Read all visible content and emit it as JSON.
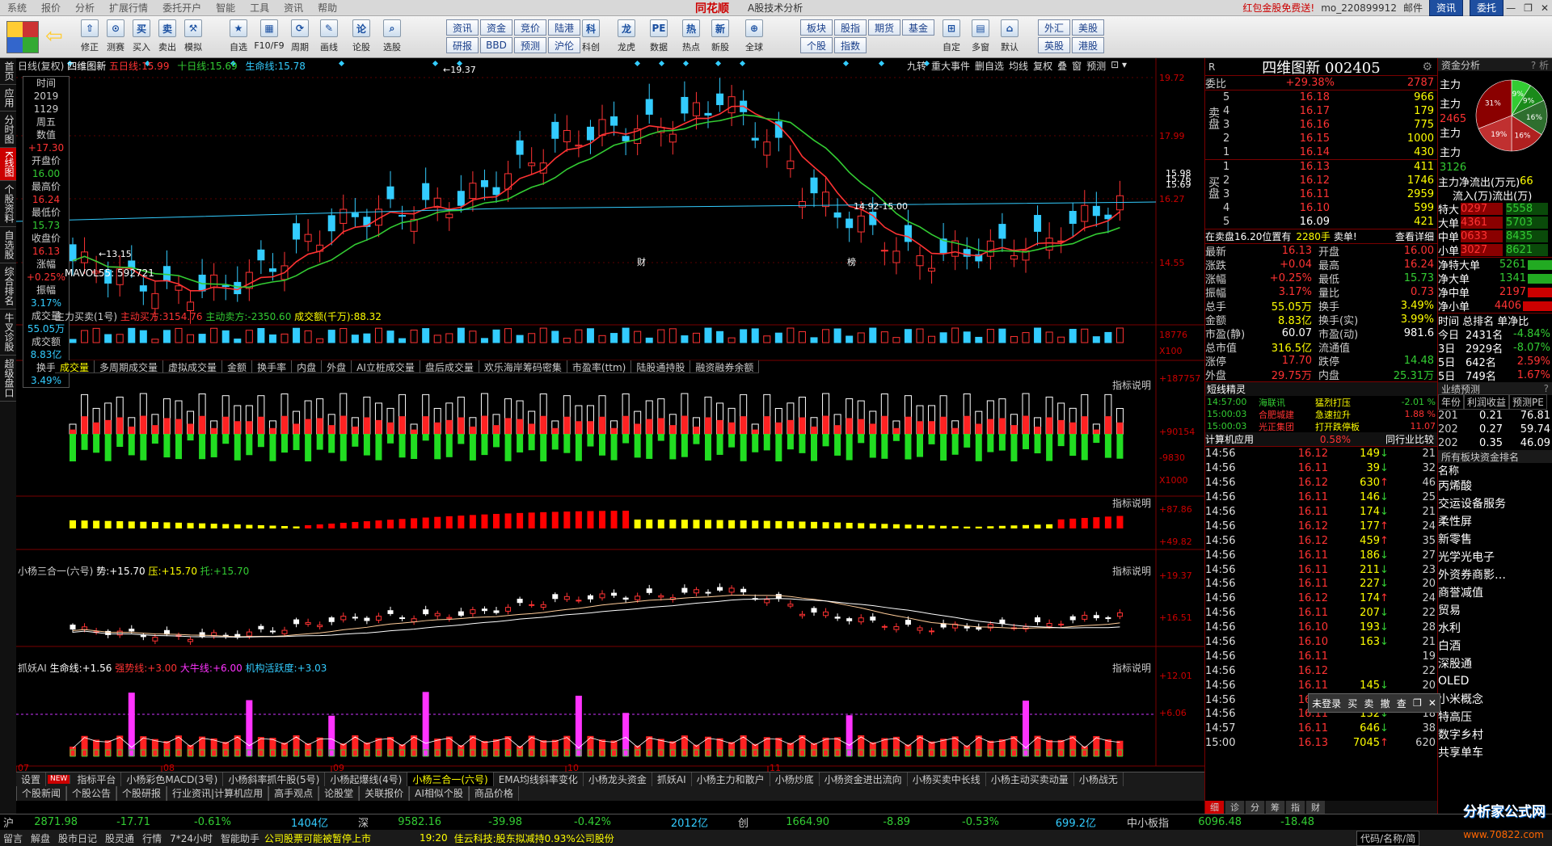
{
  "menu": {
    "items": [
      "系统",
      "报价",
      "分析",
      "扩展行情",
      "委托开户",
      "智能",
      "工具",
      "资讯",
      "帮助"
    ],
    "logo": "同花顺",
    "title": "A股技术分析",
    "promo": "红包金股免费送!",
    "user": "mo_220899912",
    "mail": "邮件",
    "news_btn": "资讯",
    "trade_btn": "委托"
  },
  "toolbar": {
    "buttons": [
      "修正",
      "测赛",
      "买入",
      "卖出",
      "模拟",
      "自选",
      "F10/F9",
      "周期",
      "画线",
      "论股",
      "选股",
      "科创",
      "龙虎",
      "数据",
      "热点",
      "新股",
      "全球",
      "自定",
      "多窗",
      "默认"
    ],
    "grid": [
      "资讯",
      "资金",
      "竞价",
      "陆港",
      "研报",
      "BBD",
      "预测",
      "沪伦",
      "板块",
      "股指",
      "期权",
      "债券",
      "英股",
      "港股",
      "个股",
      "指数",
      "期货",
      "基金",
      "外汇",
      "美股"
    ]
  },
  "leftnav": [
    "首页",
    "应用",
    "分时图",
    "K线图",
    "个股资料",
    "自选股",
    "综合排名",
    "牛叉诊股",
    "超级盘口"
  ],
  "chart": {
    "title_line": "日线(复权)",
    "stock_name": "四维图新",
    "ma5_label": "五日线:",
    "ma5": "15.99",
    "ma10_label": "十日线:",
    "ma10": "15.69",
    "life_label": "生命线:",
    "life": "15.78",
    "top_tools": [
      "九转",
      "重大事件",
      "删自选",
      "均线",
      "复权",
      "叠",
      "窗",
      "预测"
    ],
    "yaxis": [
      "19.72",
      "17.99",
      "16.27",
      "14.55"
    ],
    "price_callouts": {
      "high": "19.37",
      "low": "13.15",
      "range": "14.92-15.00",
      "p1": "15.98",
      "p2": "15.76",
      "p3": "15.69"
    },
    "markers": [
      "财",
      "榜"
    ],
    "vol_label": "MAVOL55: 592721",
    "vol_axis": [
      "18776",
      "X100"
    ],
    "ind_tabs": [
      "成交量",
      "多周期成交量",
      "虚拟成交量",
      "金额",
      "换手率",
      "内盘",
      "外盘",
      "AI立桩成交量",
      "盘后成交量",
      "欢乐海岸筹码密集",
      "市盈率(ttm)",
      "陆股通持股",
      "融资融券余额"
    ],
    "p2_label": "主力买卖(1号)",
    "p2_buy_label": "主动买方:",
    "p2_buy": "3154.76",
    "p2_sell_label": "主动卖方:",
    "p2_sell": "-2350.60",
    "p2_amt_label": "成交额(千万):",
    "p2_amt": "88.32",
    "p2_axis": [
      "+187757",
      "+90154",
      "-9830",
      "X1000"
    ],
    "p3_axis": [
      "+87.86",
      "+49.82"
    ],
    "p4_label": "小杨三合一(六号)",
    "p4_a_label": "势:",
    "p4_a": "+15.70",
    "p4_b_label": "压:",
    "p4_b": "+15.70",
    "p4_c_label": "托:",
    "p4_c": "+15.70",
    "p4_axis": [
      "+19.37",
      "+16.51"
    ],
    "p5_label": "抓妖AI",
    "p5_a_label": "生命线:",
    "p5_a": "+1.56",
    "p5_b_label": "强势线:",
    "p5_b": "+3.00",
    "p5_c_label": "大牛线:",
    "p5_c": "+6.00",
    "p5_d_label": "机构活跃度:",
    "p5_d": "+3.03",
    "p5_axis": [
      "+12.01",
      "+6.06"
    ],
    "indicator_help": "指标说明",
    "xaxis": [
      "07",
      "08",
      "09",
      "10",
      "11"
    ],
    "info": {
      "time_label": "时间",
      "year": "2019",
      "date": "1129",
      "weekday": "周五",
      "values_label": "数值",
      "v1": "+17.30",
      "open_label": "开盘价",
      "open": "16.00",
      "high_label": "最高价",
      "high": "16.24",
      "low_label": "最低价",
      "low": "15.73",
      "close_label": "收盘价",
      "close": "16.13",
      "chg_label": "涨幅",
      "chg": "+0.25%",
      "amp_label": "振幅",
      "amp": "3.17%",
      "vol_label": "成交量",
      "vol": "55.05万",
      "amt_label": "成交额",
      "amt": "8.83亿",
      "turn_label": "换手",
      "turn": "3.49%"
    }
  },
  "tabs1": [
    "设置",
    "NEW",
    "指标平台",
    "小杨彩色MACD(3号)",
    "小杨斜率抓牛股(5号)",
    "小杨起爆线(4号)",
    "小杨三合一(六号)",
    "EMA均线斜率变化",
    "小杨龙头资金",
    "抓妖AI",
    "小杨主力和散户",
    "小杨炒底",
    "小杨资金进出流向",
    "小杨买卖中长线",
    "小杨主动买卖动量",
    "小杨战无"
  ],
  "tabs2": [
    "个股新闻",
    "个股公告",
    "个股研报",
    "行业资讯|计算机应用",
    "高手观点",
    "论股堂",
    "关联报价",
    "AI相似个股",
    "商品价格"
  ],
  "quote": {
    "r": "R",
    "title": "四维图新 002405",
    "wb_label": "委比",
    "wb": "+29.38%",
    "wb_v": "2787",
    "sell_label": "卖盘",
    "buy_label": "买盘",
    "sells": [
      {
        "l": "5",
        "p": "16.18",
        "v": "966"
      },
      {
        "l": "4",
        "p": "16.17",
        "v": "179"
      },
      {
        "l": "3",
        "p": "16.16",
        "v": "775"
      },
      {
        "l": "2",
        "p": "16.15",
        "v": "1000"
      },
      {
        "l": "1",
        "p": "16.14",
        "v": "430"
      }
    ],
    "buys": [
      {
        "l": "1",
        "p": "16.13",
        "v": "411"
      },
      {
        "l": "2",
        "p": "16.12",
        "v": "1746"
      },
      {
        "l": "3",
        "p": "16.11",
        "v": "2959"
      },
      {
        "l": "4",
        "p": "16.10",
        "v": "599"
      },
      {
        "l": "5",
        "p": "16.09",
        "v": "421"
      }
    ],
    "notice_a": "在卖盘16.20位置有",
    "notice_b": "2280手",
    "notice_c": "卖单!",
    "notice_d": "查看详细",
    "kv": [
      {
        "k": "最新",
        "v": "16.13",
        "vc": "red",
        "k2": "开盘",
        "v2": "16.00",
        "v2c": "red"
      },
      {
        "k": "涨跌",
        "v": "+0.04",
        "vc": "red",
        "k2": "最高",
        "v2": "16.24",
        "v2c": "red"
      },
      {
        "k": "涨幅",
        "v": "+0.25%",
        "vc": "red",
        "k2": "最低",
        "v2": "15.73",
        "v2c": "grn"
      },
      {
        "k": "振幅",
        "v": "3.17%",
        "vc": "red",
        "k2": "量比",
        "v2": "0.73",
        "v2c": "red"
      },
      {
        "k": "总手",
        "v": "55.05万",
        "vc": "yel",
        "k2": "换手",
        "v2": "3.49%",
        "v2c": "yel"
      },
      {
        "k": "金额",
        "v": "8.83亿",
        "vc": "yel",
        "k2": "换手(实)",
        "v2": "3.99%",
        "v2c": "yel"
      },
      {
        "k": "市盈(静)",
        "v": "60.07",
        "vc": "wht",
        "k2": "市盈(动)",
        "v2": "981.6",
        "v2c": "wht"
      },
      {
        "k": "总市值",
        "v": "316.5亿",
        "vc": "yel",
        "k2": "流通值",
        "v2": "",
        "v2c": "wht"
      },
      {
        "k": "涨停",
        "v": "17.70",
        "vc": "red",
        "k2": "跌停",
        "v2": "14.48",
        "v2c": "grn"
      },
      {
        "k": "外盘",
        "v": "29.75万",
        "vc": "red",
        "k2": "内盘",
        "v2": "25.31万",
        "v2c": "grn"
      }
    ],
    "short_label": "短线精灵",
    "shorts": [
      {
        "t": "14:57:00",
        "n": "海联讯",
        "e": "猛烈打压",
        "v": "-2.01 %",
        "c": "grn"
      },
      {
        "t": "15:00:03",
        "n": "合肥城建",
        "e": "急速拉升",
        "v": "1.88 %",
        "c": "red"
      },
      {
        "t": "15:00:03",
        "n": "光正集团",
        "e": "打开跌停板",
        "v": "11.07",
        "c": "red"
      }
    ],
    "sector": "计算机应用",
    "sector_chg": "0.58%",
    "compare": "同行业比较",
    "ticks": [
      [
        "14:56",
        "16.12",
        "149",
        "dn",
        "21"
      ],
      [
        "14:56",
        "16.11",
        "39",
        "dn",
        "32"
      ],
      [
        "14:56",
        "16.12",
        "630",
        "up",
        "46"
      ],
      [
        "14:56",
        "16.11",
        "146",
        "dn",
        "25"
      ],
      [
        "14:56",
        "16.11",
        "174",
        "dn",
        "21"
      ],
      [
        "14:56",
        "16.12",
        "177",
        "up",
        "24"
      ],
      [
        "14:56",
        "16.12",
        "459",
        "up",
        "35"
      ],
      [
        "14:56",
        "16.11",
        "186",
        "dn",
        "27"
      ],
      [
        "14:56",
        "16.11",
        "211",
        "dn",
        "23"
      ],
      [
        "14:56",
        "16.11",
        "227",
        "dn",
        "20"
      ],
      [
        "14:56",
        "16.12",
        "174",
        "up",
        "24"
      ],
      [
        "14:56",
        "16.11",
        "207",
        "dn",
        "22"
      ],
      [
        "14:56",
        "16.10",
        "193",
        "dn",
        "28"
      ],
      [
        "14:56",
        "16.10",
        "163",
        "dn",
        "21"
      ],
      [
        "14:56",
        "16.11",
        "",
        "",
        "19"
      ],
      [
        "14:56",
        "16.12",
        "",
        "",
        "22"
      ],
      [
        "14:56",
        "16.11",
        "145",
        "dn",
        "20"
      ],
      [
        "14:56",
        "16.11",
        "201",
        "dn",
        "24"
      ],
      [
        "14:56",
        "16.11",
        "132",
        "dn",
        "18"
      ],
      [
        "14:57",
        "16.11",
        "646",
        "dn",
        "38"
      ],
      [
        "15:00",
        "16.13",
        "7045",
        "up",
        "620"
      ]
    ],
    "bottom_tabs": [
      "细",
      "诊",
      "分",
      "筹",
      "指",
      "财"
    ]
  },
  "rpanel": {
    "header": "资金分析",
    "pie": [
      "9%",
      "9%",
      "16%",
      "16%",
      "19%",
      "31%"
    ],
    "main_labels": [
      "主力",
      "主力",
      "主力",
      "主力"
    ],
    "main_vals": [
      "",
      "2465",
      "",
      "3126"
    ],
    "net_label": "主力净流出(万元)",
    "net_val": "66",
    "flow_head": "流入(万)流出(万)",
    "flows": [
      {
        "k": "特大",
        "a": "0297",
        "b": "5558"
      },
      {
        "k": "大单",
        "a": "4361",
        "b": "5703"
      },
      {
        "k": "中单",
        "a": "0633",
        "b": "8435"
      },
      {
        "k": "小单",
        "a": "3027",
        "b": "8621"
      }
    ],
    "nets": [
      {
        "k": "净特大单",
        "v": "5261",
        "c": "grn"
      },
      {
        "k": "净大单",
        "v": "1341",
        "c": "grn"
      },
      {
        "k": "净中单",
        "v": "2197",
        "c": "red"
      },
      {
        "k": "净小单",
        "v": "4406",
        "c": "red"
      }
    ],
    "rank_head": "时间 总排名 单净比",
    "ranks": [
      {
        "k": "今日",
        "a": "2431名",
        "b": "-4.84%",
        "c": "grn"
      },
      {
        "k": "3日",
        "a": "2929名",
        "b": "-8.07%",
        "c": "grn"
      },
      {
        "k": "5日",
        "a": "642名",
        "b": "2.59%",
        "c": "red"
      },
      {
        "k": "5日",
        "a": "749名",
        "b": "1.67%",
        "c": "red"
      }
    ],
    "perf_head": "业绩预测",
    "perf_tabs": [
      "年份",
      "利润收益",
      "预测PE"
    ],
    "perf": [
      {
        "y": "201",
        "a": "0.21",
        "b": "76.81"
      },
      {
        "y": "202",
        "a": "0.27",
        "b": "59.74"
      },
      {
        "y": "202",
        "a": "0.35",
        "b": "46.09"
      }
    ],
    "sector_head": "所有板块资金排名",
    "sector_title": "名称",
    "sectors": [
      "丙烯酸",
      "交运设备服务",
      "柔性屏",
      "新零售",
      "光学光电子",
      "外资券商影…",
      "商誉减值",
      "贸易",
      "水利",
      "白酒",
      "深股通",
      "OLED",
      "小米概念",
      "特高压",
      "数字乡村",
      "共享单车"
    ]
  },
  "status": {
    "idx1": "沪",
    "v1": "2871.98",
    "c1": "-17.71",
    "p1": "-0.61%",
    "a1": "1404亿",
    "idx2": "深",
    "v2": "9582.16",
    "c2": "-39.98",
    "p2": "-0.42%",
    "a2": "2012亿",
    "idx3": "创",
    "v3": "1664.90",
    "c3": "-8.89",
    "p3": "-0.53%",
    "a3": "699.2亿",
    "idx4": "中小板指",
    "v4": "6096.48",
    "c4": "-18.48"
  },
  "status2": {
    "items": [
      "留言",
      "解盘",
      "股市日记",
      "股灵通",
      "行情",
      "7*24小时",
      "智能助手"
    ],
    "news": "公司股票可能被暂停上市",
    "ticker_time": "19:20",
    "ticker": "佳云科技:股东拟减持0.93%公司股份",
    "code": "代码/名称/简"
  },
  "popup": {
    "login": "未登录",
    "b": "买",
    "s": "卖",
    "c": "撤",
    "q": "查"
  },
  "watermark": "分析家公式网",
  "watermark_url": "www.70822.com"
}
